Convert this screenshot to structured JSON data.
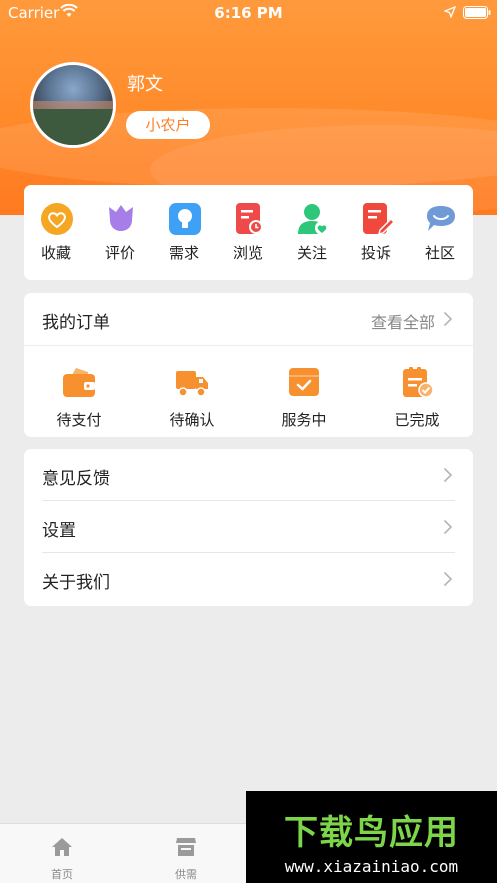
{
  "status_bar": {
    "carrier": "Carrier",
    "time": "6:16 PM"
  },
  "profile": {
    "name": "郭文",
    "role": "小农户"
  },
  "quick_menu": [
    {
      "label": "收藏",
      "icon": "heart-icon",
      "color": "#f5a623"
    },
    {
      "label": "评价",
      "icon": "flower-icon",
      "color": "#a77ee8"
    },
    {
      "label": "需求",
      "icon": "lightbulb-icon",
      "color": "#3ea1f5"
    },
    {
      "label": "浏览",
      "icon": "history-doc-icon",
      "color": "#ef4a4a"
    },
    {
      "label": "关注",
      "icon": "user-heart-icon",
      "color": "#2ec77a"
    },
    {
      "label": "投诉",
      "icon": "edit-doc-icon",
      "color": "#f0483d"
    },
    {
      "label": "社区",
      "icon": "chat-bubble-icon",
      "color": "#6f9ad6"
    }
  ],
  "orders": {
    "title": "我的订单",
    "view_all": "查看全部",
    "items": [
      {
        "label": "待支付",
        "icon": "wallet-icon"
      },
      {
        "label": "待确认",
        "icon": "truck-icon"
      },
      {
        "label": "服务中",
        "icon": "box-check-icon"
      },
      {
        "label": "已完成",
        "icon": "clipboard-check-icon"
      }
    ]
  },
  "menu": [
    {
      "label": "意见反馈"
    },
    {
      "label": "设置"
    },
    {
      "label": "关于我们"
    }
  ],
  "tabbar": [
    {
      "label": "首页",
      "icon": "home-icon"
    },
    {
      "label": "供需",
      "icon": "store-icon"
    }
  ],
  "watermark": {
    "title": "下载鸟应用",
    "url": "www.xiazainiao.com"
  },
  "colors": {
    "accent": "#ff8a2a",
    "badge_text": "#ff7e22",
    "order_icon": "#f7912f"
  }
}
